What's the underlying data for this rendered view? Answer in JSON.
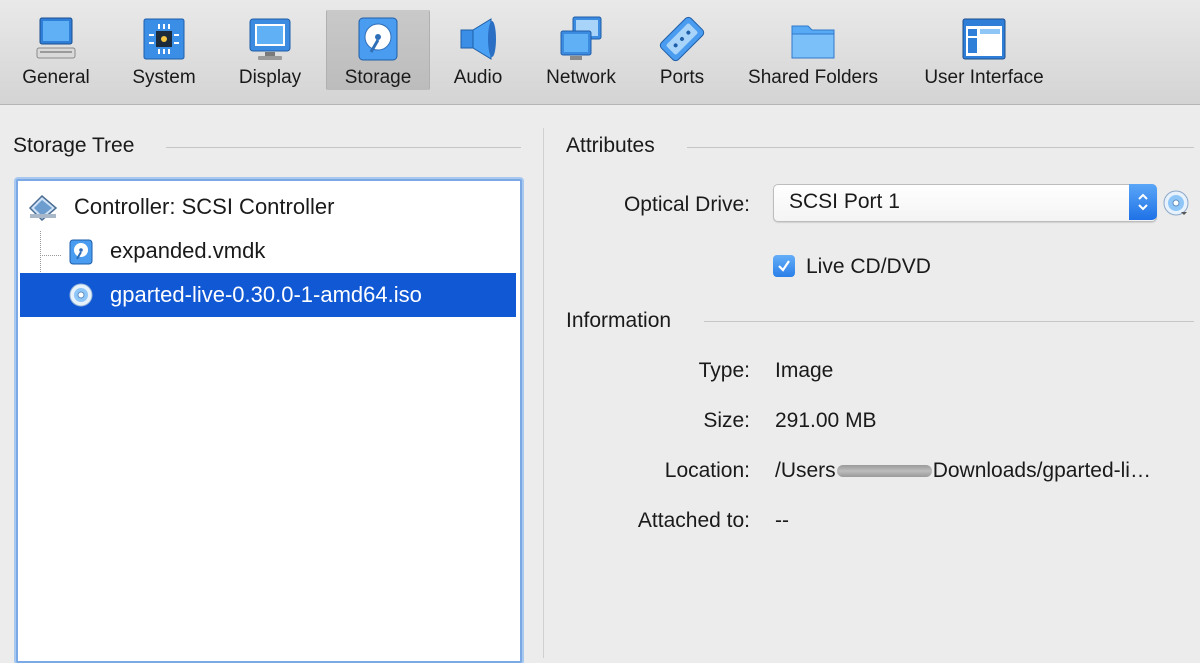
{
  "toolbar": {
    "items": [
      {
        "label": "General",
        "icon": "general-icon"
      },
      {
        "label": "System",
        "icon": "system-icon"
      },
      {
        "label": "Display",
        "icon": "display-icon"
      },
      {
        "label": "Storage",
        "icon": "storage-icon",
        "active": true
      },
      {
        "label": "Audio",
        "icon": "audio-icon"
      },
      {
        "label": "Network",
        "icon": "network-icon"
      },
      {
        "label": "Ports",
        "icon": "ports-icon"
      },
      {
        "label": "Shared Folders",
        "icon": "shared-folders-icon"
      },
      {
        "label": "User Interface",
        "icon": "user-interface-icon"
      }
    ]
  },
  "storage_tree": {
    "title": "Storage Tree",
    "controller": "Controller: SCSI Controller",
    "items": [
      {
        "label": "expanded.vmdk",
        "icon": "hard-disk-icon"
      },
      {
        "label": "gparted-live-0.30.0-1-amd64.iso",
        "icon": "optical-disc-icon",
        "selected": true
      }
    ]
  },
  "attributes": {
    "title": "Attributes",
    "optical_drive_label": "Optical Drive:",
    "optical_drive_value": "SCSI Port 1",
    "live_cd_label": "Live CD/DVD",
    "live_cd_checked": true
  },
  "information": {
    "title": "Information",
    "type_label": "Type:",
    "type_value": "Image",
    "size_label": "Size:",
    "size_value": "291.00 MB",
    "location_label": "Location:",
    "location_prefix": "/Users",
    "location_suffix": "Downloads/gparted-li…",
    "attached_label": "Attached to:",
    "attached_value": "--"
  },
  "colors": {
    "selection": "#1158d4",
    "accent": "#2a7fe8",
    "toolbar_bg": "#d4d4d4"
  }
}
